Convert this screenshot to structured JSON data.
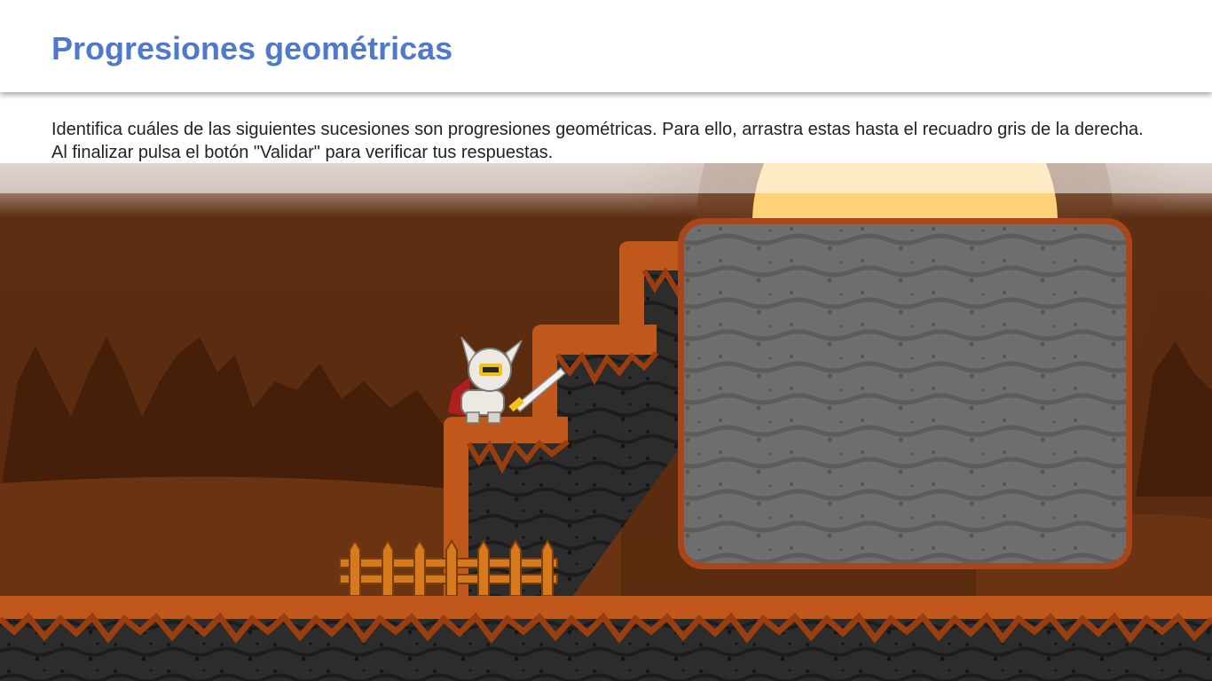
{
  "header": {
    "title": "Progresiones geométricas"
  },
  "instructions": {
    "text": "Identifica cuáles de las siguientes sucesiones son progresiones geométricas. Para ello, arrastra estas hasta el recuadro gris de la derecha. Al finalizar pulsa el botón \"Validar\" para verificar tus respuestas."
  },
  "scene": {
    "character": "knight-character",
    "drop_zone": "drop-zone",
    "colors": {
      "title": "#4f7acb",
      "sky": "#5a2d10",
      "hills": "#6a3412",
      "trees": "#451f0a",
      "dirt": "#c0581b",
      "rock": "#2b2b2b",
      "drop_zone_fill": "#6b6b6b",
      "drop_zone_border": "#a8451a",
      "sun": "#ffd27a"
    }
  }
}
